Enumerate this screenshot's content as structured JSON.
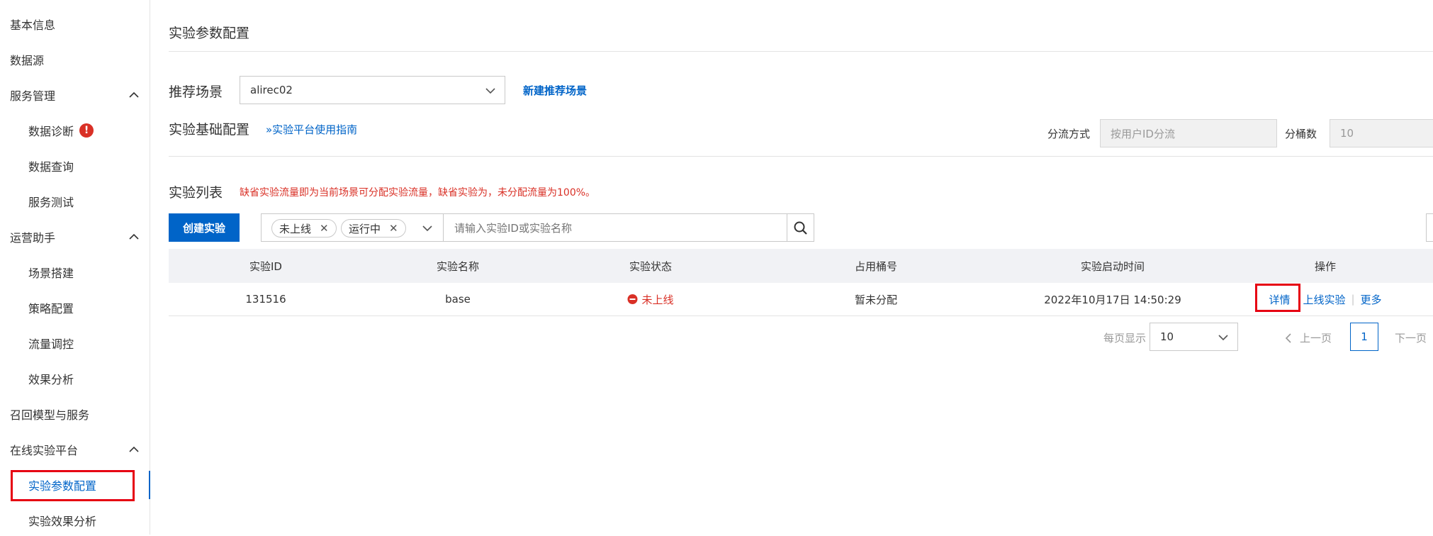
{
  "sidebar": {
    "items": [
      {
        "label": "基本信息",
        "type": "top"
      },
      {
        "label": "数据源",
        "type": "top"
      },
      {
        "label": "服务管理",
        "type": "top",
        "expanded": true
      },
      {
        "label": "数据诊断",
        "type": "sub",
        "alert": "!"
      },
      {
        "label": "数据查询",
        "type": "sub"
      },
      {
        "label": "服务测试",
        "type": "sub"
      },
      {
        "label": "运营助手",
        "type": "top",
        "expanded": true
      },
      {
        "label": "场景搭建",
        "type": "sub"
      },
      {
        "label": "策略配置",
        "type": "sub"
      },
      {
        "label": "流量调控",
        "type": "sub"
      },
      {
        "label": "效果分析",
        "type": "sub"
      },
      {
        "label": "召回模型与服务",
        "type": "top"
      },
      {
        "label": "在线实验平台",
        "type": "top",
        "expanded": true
      },
      {
        "label": "实验参数配置",
        "type": "sub",
        "active": true
      },
      {
        "label": "实验效果分析",
        "type": "sub"
      }
    ]
  },
  "page": {
    "title": "实验参数配置",
    "scene_label": "推荐场景",
    "scene_value": "alirec02",
    "new_scene_link": "新建推荐场景",
    "base_config_label": "实验基础配置",
    "guide_link": "»实验平台使用指南",
    "split_method_label": "分流方式",
    "split_method_value": "按用户ID分流",
    "buckets_label": "分桶数",
    "buckets_value": "10",
    "list_label": "实验列表",
    "list_warning": "缺省实验流量即为当前场景可分配实验流量，缺省实验为，未分配流量为100%。",
    "create_button": "创建实验",
    "filter_tags": [
      "未上线",
      "运行中"
    ],
    "search_placeholder": "请输入实验ID或实验名称"
  },
  "table": {
    "headers": [
      "实验ID",
      "实验名称",
      "实验状态",
      "占用桶号",
      "实验启动时间",
      "操作"
    ],
    "rows": [
      {
        "id": "131516",
        "name": "base",
        "status": "未上线",
        "bucket": "暂未分配",
        "start_time": "2022年10月17日 14:50:29",
        "actions": [
          "详情",
          "上线实验",
          "更多"
        ]
      }
    ]
  },
  "pagination": {
    "per_page_label": "每页显示",
    "per_page_value": "10",
    "prev_label": "上一页",
    "current_page": "1",
    "next_label": "下一页"
  },
  "colors": {
    "accent": "#0064c8",
    "danger": "#d93026",
    "highlight_box": "#e60012"
  }
}
